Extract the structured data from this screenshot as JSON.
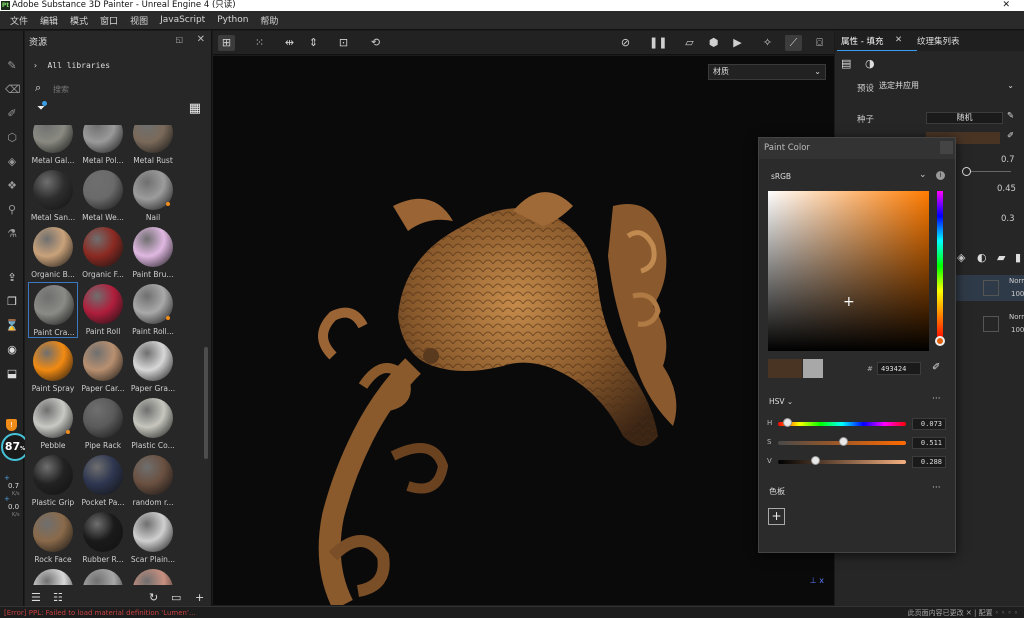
{
  "window": {
    "title": "Adobe Substance 3D Painter - Unreal Engine 4 (只读)",
    "close": "✕"
  },
  "menu": [
    "文件",
    "编辑",
    "模式",
    "窗口",
    "视图",
    "JavaScript",
    "Python",
    "帮助"
  ],
  "assets": {
    "title": "资源",
    "libraries": "All libraries",
    "search_placeholder": "搜索",
    "materials": [
      {
        "label": "Metal Gal...",
        "color": "#8a8a82"
      },
      {
        "label": "Metal Pol...",
        "color": "#9a9a9a"
      },
      {
        "label": "Metal Rust",
        "color": "#7a6a5a"
      },
      {
        "label": "Metal San...",
        "color": "#2d2d2d"
      },
      {
        "label": "Metal We...",
        "color": "#6a6a6a"
      },
      {
        "label": "Nail",
        "color": "#9c9c9c"
      },
      {
        "label": "Organic B...",
        "color": "#c9a27a"
      },
      {
        "label": "Organic F...",
        "color": "#8b2a22"
      },
      {
        "label": "Paint Bru...",
        "color": "#e0b8e2"
      },
      {
        "label": "Paint Cra...",
        "color": "#8a8a86"
      },
      {
        "label": "Paint Roll",
        "color": "#b01e3c"
      },
      {
        "label": "Paint Roll...",
        "color": "#a9a9a9"
      },
      {
        "label": "Paint Spray",
        "color": "#f28a12"
      },
      {
        "label": "Paper Car...",
        "color": "#b89070"
      },
      {
        "label": "Paper Gra...",
        "color": "#d7d7d7"
      },
      {
        "label": "Pebble",
        "color": "#c8c8c4"
      },
      {
        "label": "Pipe Rack",
        "color": "#5a5a5a"
      },
      {
        "label": "Plastic Co...",
        "color": "#c6c6be"
      },
      {
        "label": "Plastic Grip",
        "color": "#222222"
      },
      {
        "label": "Pocket Pa...",
        "color": "#2e3650"
      },
      {
        "label": "random r...",
        "color": "#6a5040"
      },
      {
        "label": "Rock Face",
        "color": "#8a6a4a"
      },
      {
        "label": "Rubber R...",
        "color": "#1a1a1a"
      },
      {
        "label": "Scar Plain...",
        "color": "#cfcfcf"
      },
      {
        "label": "",
        "color": "#d8d8d8"
      },
      {
        "label": "",
        "color": "#a8a8a8"
      },
      {
        "label": "",
        "color": "#c89080"
      }
    ],
    "selected_index": 9,
    "dot_indices": [
      5,
      11,
      15
    ]
  },
  "perf": {
    "value": "87",
    "unit": "%",
    "up": "0.7",
    "down": "0.0",
    "rate": "K/s"
  },
  "viewport": {
    "dropdown": "材质"
  },
  "right_panel": {
    "tab_active": "属性 - 填充",
    "tab_other": "纹理集列表",
    "preset_label": "预设",
    "preset_value": "选定并应用",
    "seed_label": "种子",
    "seed_value": "随机",
    "v1": "0.7",
    "v2": "0.45",
    "v3": "0.3",
    "layers": [
      {
        "name": "Norm",
        "value": "100"
      },
      {
        "name": "Norm",
        "value": "100"
      }
    ]
  },
  "paint_color": {
    "title": "Paint Color",
    "colorspace": "sRGB",
    "hex": "493424",
    "hex_color": "#493424",
    "mode": "HSV",
    "h": "0.073",
    "s": "0.511",
    "v": "0.288",
    "h_fraction": 0.073,
    "s_fraction": 0.511,
    "v_fraction": 0.288,
    "palette_label": "色板"
  },
  "status": {
    "message": "[Error] PPL: Failed to load material definition 'Lumen'...",
    "right": "此页面内容已更改  ✕  |  配置 ◦ ◦ ◦ ◦"
  }
}
